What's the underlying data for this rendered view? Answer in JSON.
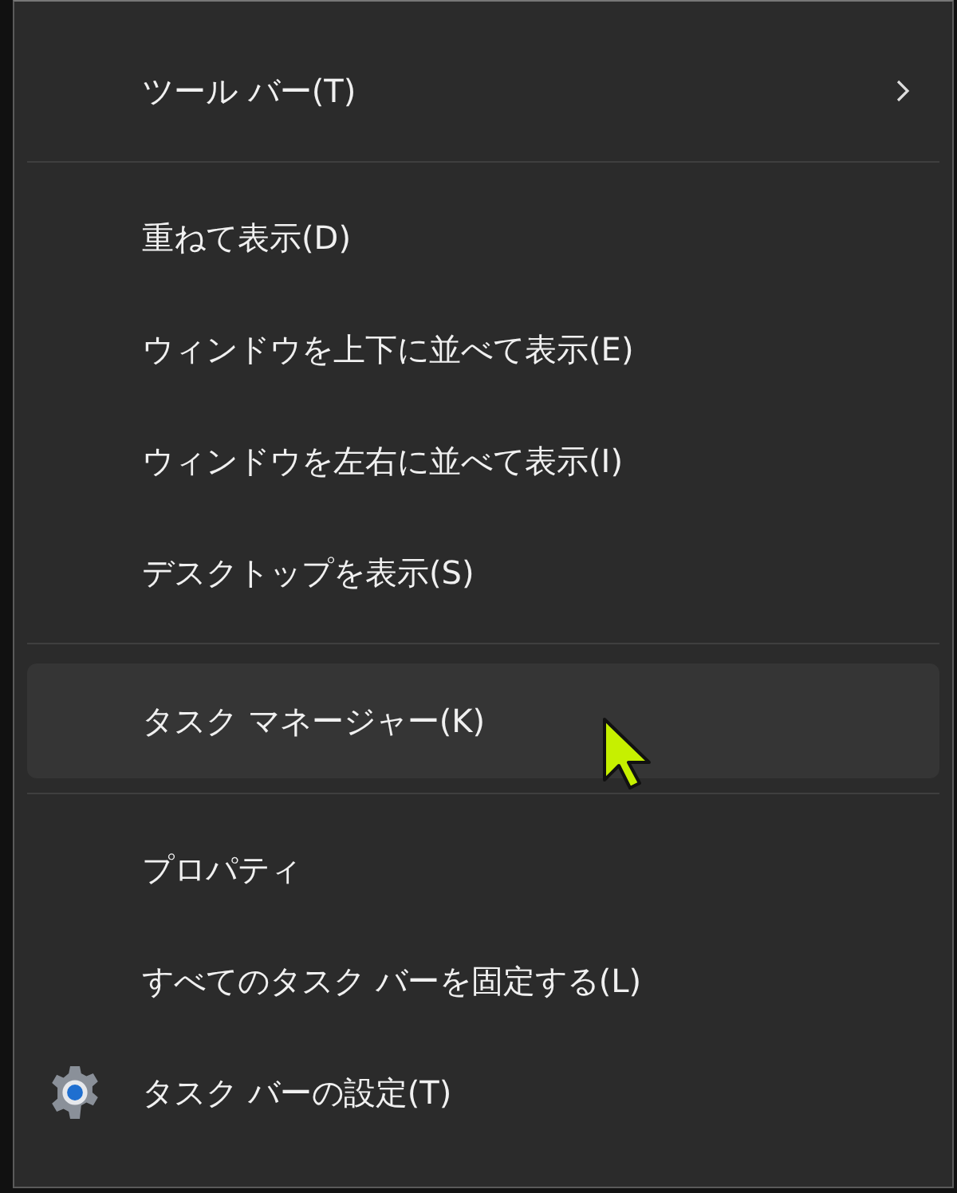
{
  "menu": {
    "groups": [
      [
        {
          "label": "ツール バー(T)",
          "kind": "submenu",
          "selected": false
        }
      ],
      [
        {
          "label": "重ねて表示(D)",
          "kind": "command",
          "selected": false
        },
        {
          "label": "ウィンドウを上下に並べて表示(E)",
          "kind": "command",
          "selected": false
        },
        {
          "label": "ウィンドウを左右に並べて表示(I)",
          "kind": "command",
          "selected": false
        },
        {
          "label": "デスクトップを表示(S)",
          "kind": "command",
          "selected": false
        }
      ],
      [
        {
          "label": "タスク マネージャー(K)",
          "kind": "command",
          "selected": true
        }
      ],
      [
        {
          "label": "プロパティ",
          "kind": "command",
          "selected": false
        },
        {
          "label": "すべてのタスク バーを固定する(L)",
          "kind": "command",
          "selected": false
        },
        {
          "label": "タスク バーの設定(T)",
          "kind": "settings",
          "selected": false
        }
      ]
    ]
  }
}
